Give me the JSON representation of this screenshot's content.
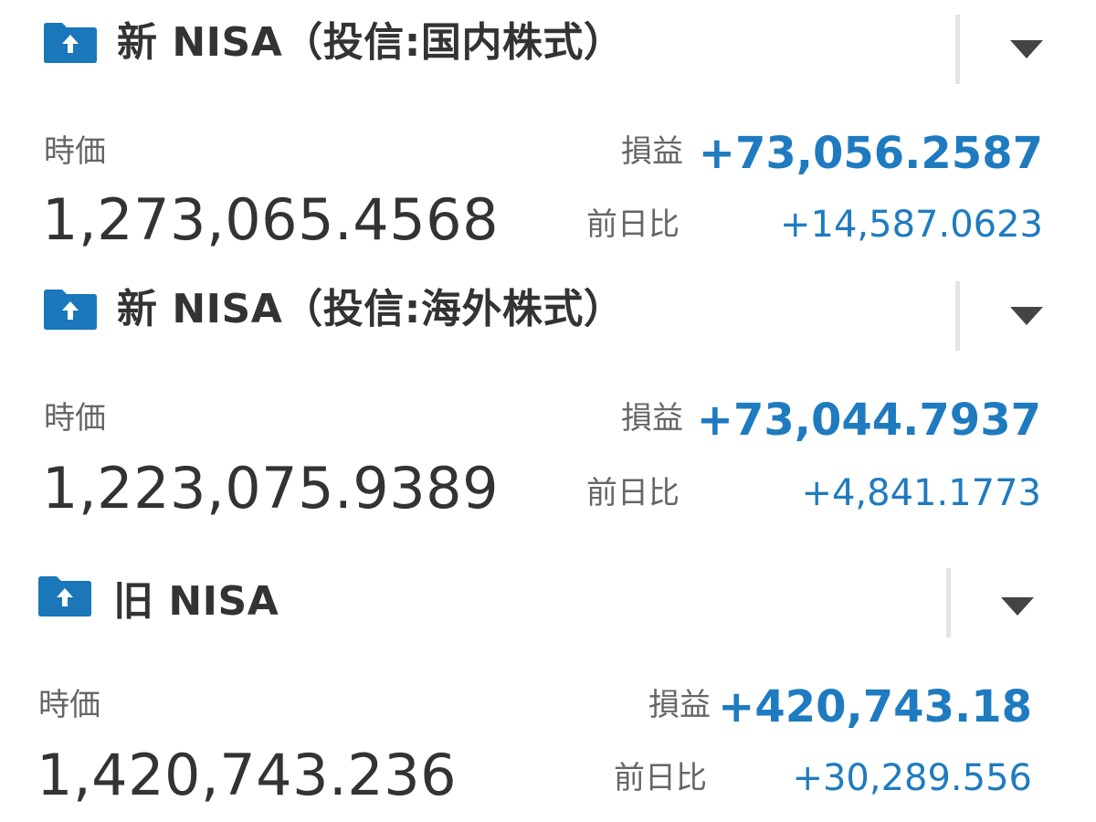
{
  "colors": {
    "accent": "#1f7bbf",
    "folder": "#1a77b9",
    "text_primary": "#333333",
    "text_secondary": "#666666",
    "divider": "#e3e3e3"
  },
  "icons": {
    "folder": "folder-upload-icon",
    "toggle": "triangle-down-icon"
  },
  "accounts": [
    {
      "title": "新 NISA（投信:国内株式）",
      "market_value_label": "時価",
      "market_value": "1,273,065.4568",
      "profit_loss_label": "損益",
      "profit_loss": "+73,056.2587",
      "day_change_label": "前日比",
      "day_change": "+14,587.0623"
    },
    {
      "title": "新 NISA（投信:海外株式）",
      "market_value_label": "時価",
      "market_value": "1,223,075.9389",
      "profit_loss_label": "損益",
      "profit_loss": "+73,044.7937",
      "day_change_label": "前日比",
      "day_change": "+4,841.1773"
    },
    {
      "title": "旧 NISA",
      "market_value_label": "時価",
      "market_value": "1,420,743.236",
      "profit_loss_label": "損益",
      "profit_loss": "+420,743.18",
      "day_change_label": "前日比",
      "day_change": "+30,289.556"
    }
  ]
}
